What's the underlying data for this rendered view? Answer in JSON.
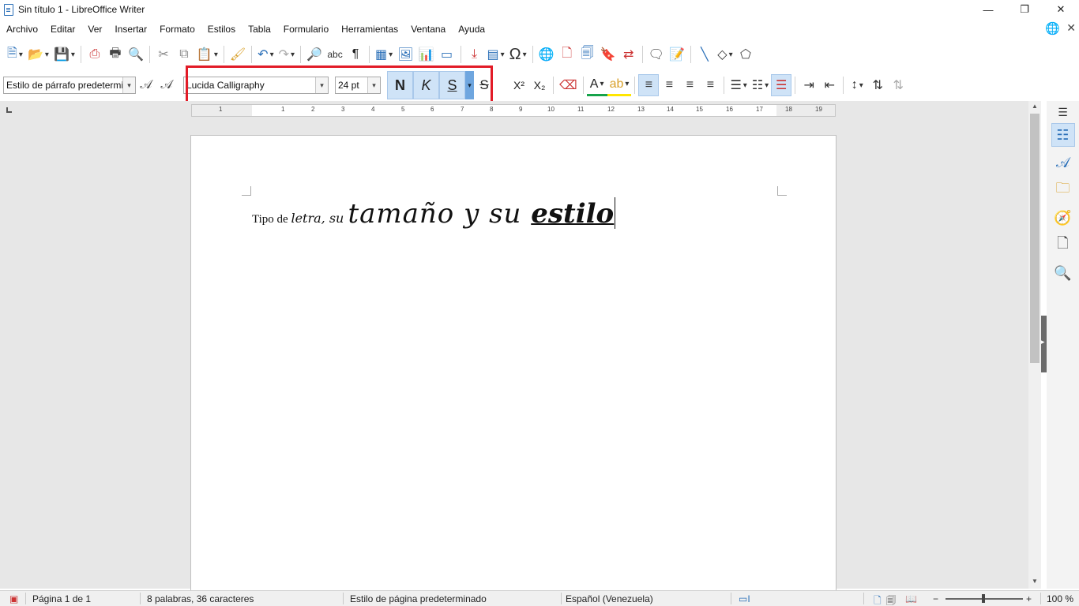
{
  "window": {
    "title": "Sin título 1 - LibreOffice Writer",
    "minimize": "—",
    "maximize": "❐",
    "close": "✕"
  },
  "menu": {
    "items": [
      "Archivo",
      "Editar",
      "Ver",
      "Insertar",
      "Formato",
      "Estilos",
      "Tabla",
      "Formulario",
      "Herramientas",
      "Ventana",
      "Ayuda"
    ],
    "close_doc": "✕"
  },
  "formatting": {
    "paragraph_style": "Estilo de párrafo predetermin",
    "font_name": "Lucida Calligraphy",
    "font_size": "24 pt",
    "bold_label": "N",
    "italic_label": "K",
    "underline_label": "S",
    "strike_label": "S",
    "superscript_label": "X²",
    "subscript_label": "X₂",
    "highlight_color": "#e21b27"
  },
  "ruler": {
    "numbers": [
      "1",
      "1",
      "2",
      "3",
      "4",
      "5",
      "6",
      "7",
      "8",
      "9",
      "10",
      "11",
      "12",
      "13",
      "14",
      "15",
      "16",
      "17",
      "18",
      "19"
    ]
  },
  "document": {
    "text_small": "Tipo de ",
    "text_italic": "letra, su ",
    "text_big": "tamaño y su ",
    "text_bigbold": "estilo"
  },
  "status": {
    "page": "Página 1 de 1",
    "words": "8 palabras, 36 caracteres",
    "page_style": "Estilo de página predeterminado",
    "language": "Español (Venezuela)",
    "zoom": "100 %"
  },
  "icons": {
    "new": "new-document-icon",
    "open": "open-folder-icon",
    "save": "save-icon"
  }
}
